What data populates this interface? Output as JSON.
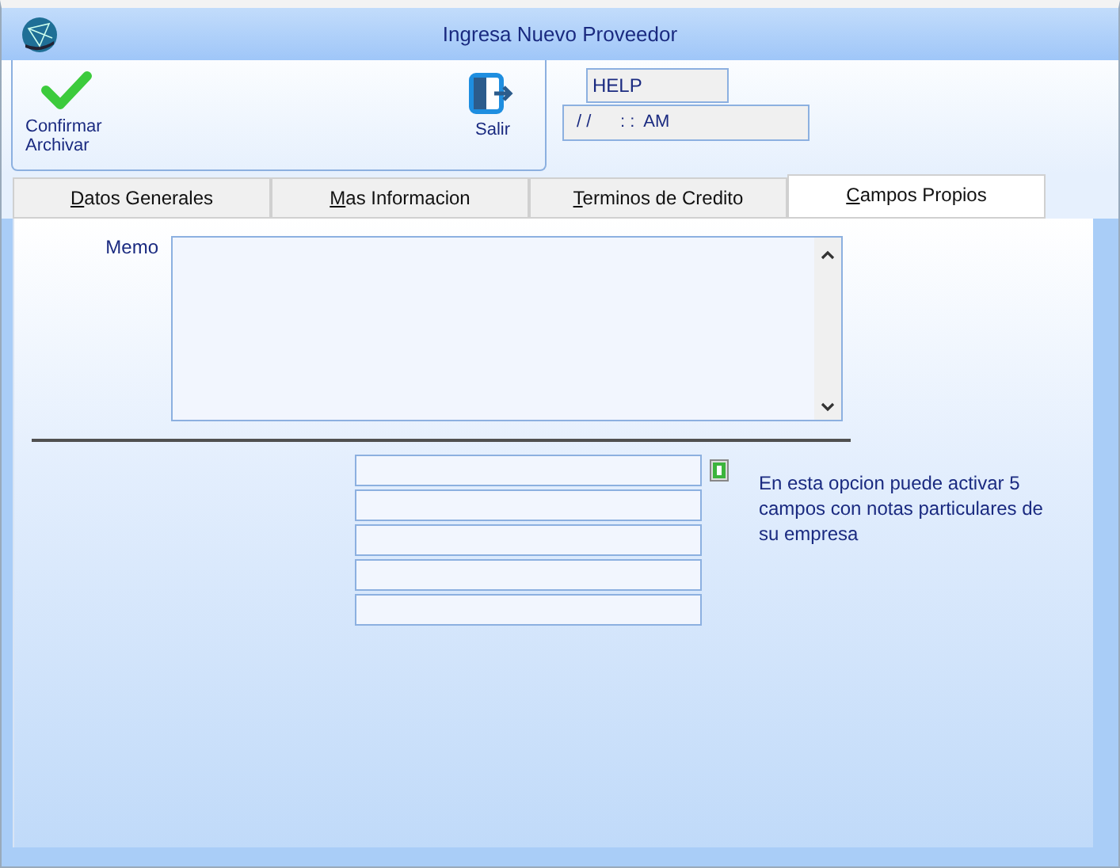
{
  "window": {
    "title": "Ingresa Nuevo Proveedor"
  },
  "toolbar": {
    "buttons": [
      {
        "kind": "confirm",
        "label": "Confirmar Archivar"
      },
      {
        "kind": "exit",
        "label": "Salir"
      }
    ]
  },
  "help_field": {
    "value": "HELP"
  },
  "datetime_field": {
    "value": "/ /      : :  AM"
  },
  "tabs": [
    {
      "label": "Datos Generales",
      "selected": false
    },
    {
      "label": "Mas Informacion",
      "selected": false
    },
    {
      "label": "Terminos de Credito",
      "selected": false
    },
    {
      "label": "Campos Propios",
      "selected": true
    }
  ],
  "memo": {
    "label": "Memo"
  },
  "custom_fields": {
    "note": "En esta opcion puede activar 5 campos con notas particulares de su empresa"
  }
}
